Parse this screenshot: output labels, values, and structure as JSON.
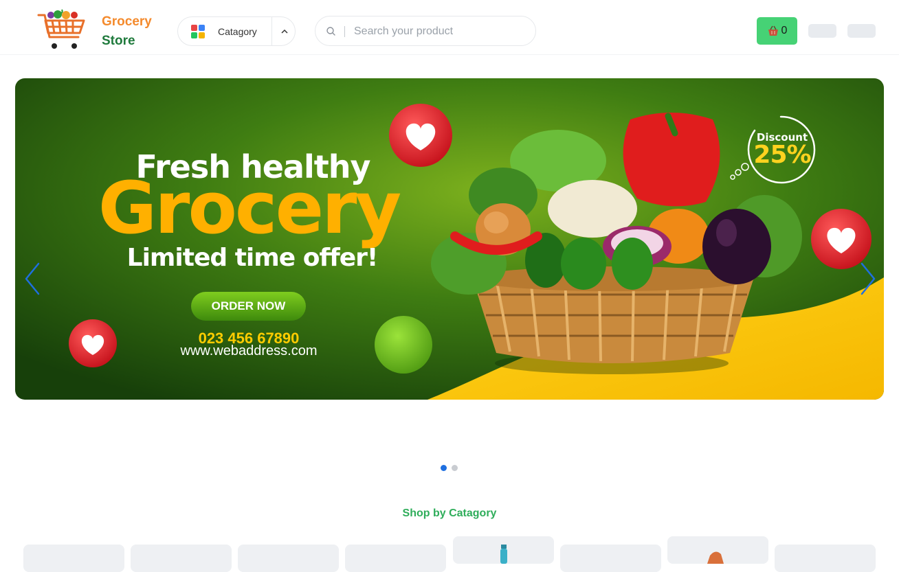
{
  "header": {
    "brand_line1": "Grocery",
    "brand_line2": "Store",
    "category_label": "Catagory",
    "search_placeholder": "Search your product",
    "cart_count": "0"
  },
  "banner": {
    "headline_top": "Fresh healthy",
    "headline_main": "Grocery",
    "headline_bottom": "Limited time offer!",
    "cta": "ORDER NOW",
    "phone": "023 456 67890",
    "website": "www.webaddress.com",
    "discount_label": "Discount",
    "discount_value": "25%"
  },
  "slider": {
    "slides": 2,
    "active": 0
  },
  "section": {
    "title": "Shop by Catagory"
  },
  "colors": {
    "brand_orange": "#f48a2c",
    "brand_green": "#1f7a3c",
    "accent_green": "#46d275",
    "section_green": "#2ead5a",
    "banner_green": "#2f6d10",
    "banner_yellow": "#ffcc00",
    "active_dot": "#1e6fe0"
  },
  "icons": [
    "shopping-cart-logo-icon",
    "category-grid-icon",
    "chevron-up-icon",
    "search-icon",
    "basket-icon",
    "chevron-left-icon",
    "chevron-right-icon",
    "heart-icon"
  ]
}
